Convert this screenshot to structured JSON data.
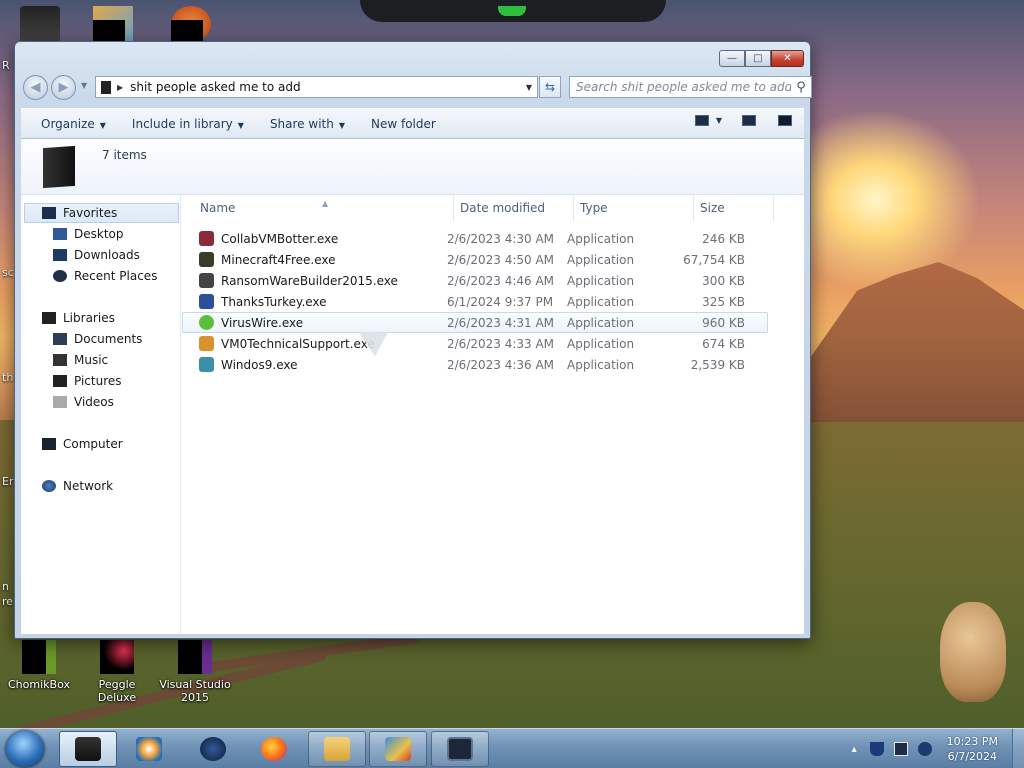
{
  "window": {
    "address_path": "shit people asked me to add",
    "search_placeholder": "Search shit people asked me to add",
    "item_count": "7 items",
    "controls": {
      "minimize": "—",
      "maximize": "□",
      "close": "✕"
    }
  },
  "toolbar": {
    "organize": "Organize",
    "include_in_library": "Include in library",
    "share_with": "Share with",
    "new_folder": "New folder"
  },
  "nav_pane": {
    "favorites": "Favorites",
    "desktop": "Desktop",
    "downloads": "Downloads",
    "recent_places": "Recent Places",
    "libraries": "Libraries",
    "documents": "Documents",
    "music": "Music",
    "pictures": "Pictures",
    "videos": "Videos",
    "computer": "Computer",
    "network": "Network"
  },
  "columns": {
    "name": "Name",
    "date_modified": "Date modified",
    "type": "Type",
    "size": "Size"
  },
  "files": [
    {
      "name": "CollabVMBotter.exe",
      "date": "2/6/2023 4:30 AM",
      "type": "Application",
      "size": "246 KB",
      "icon_color": "#8a2a3a"
    },
    {
      "name": "Minecraft4Free.exe",
      "date": "2/6/2023 4:50 AM",
      "type": "Application",
      "size": "67,754 KB",
      "icon_color": "#3b3b2a"
    },
    {
      "name": "RansomWareBuilder2015.exe",
      "date": "2/6/2023 4:46 AM",
      "type": "Application",
      "size": "300 KB",
      "icon_color": "#444444"
    },
    {
      "name": "ThanksTurkey.exe",
      "date": "6/1/2024 9:37 PM",
      "type": "Application",
      "size": "325 KB",
      "icon_color": "#2b4f9a"
    },
    {
      "name": "VirusWire.exe",
      "date": "2/6/2023 4:31 AM",
      "type": "Application",
      "size": "960 KB",
      "icon_color": "#5cbf3a"
    },
    {
      "name": "VM0TechnicalSupport.exe",
      "date": "2/6/2023 4:33 AM",
      "type": "Application",
      "size": "674 KB",
      "icon_color": "#d9922e"
    },
    {
      "name": "Windos9.exe",
      "date": "2/6/2023 4:36 AM",
      "type": "Application",
      "size": "2,539 KB",
      "icon_color": "#3c8fa8"
    }
  ],
  "desktop": {
    "icon_chomikbox": "ChomikBox",
    "icon_peggle": "Peggle Deluxe",
    "icon_vs": "Visual Studio 2015",
    "edge_labels": [
      "R",
      "sc",
      "th",
      "Er",
      "n",
      "re"
    ]
  },
  "taskbar": {
    "clock_time": "10:23 PM",
    "clock_date": "6/7/2024",
    "tray_caret": "▴"
  },
  "colors": {
    "taskbar": "#6f92b6",
    "window_frame": "#c9d9ea",
    "close_button": "#c4402f"
  }
}
